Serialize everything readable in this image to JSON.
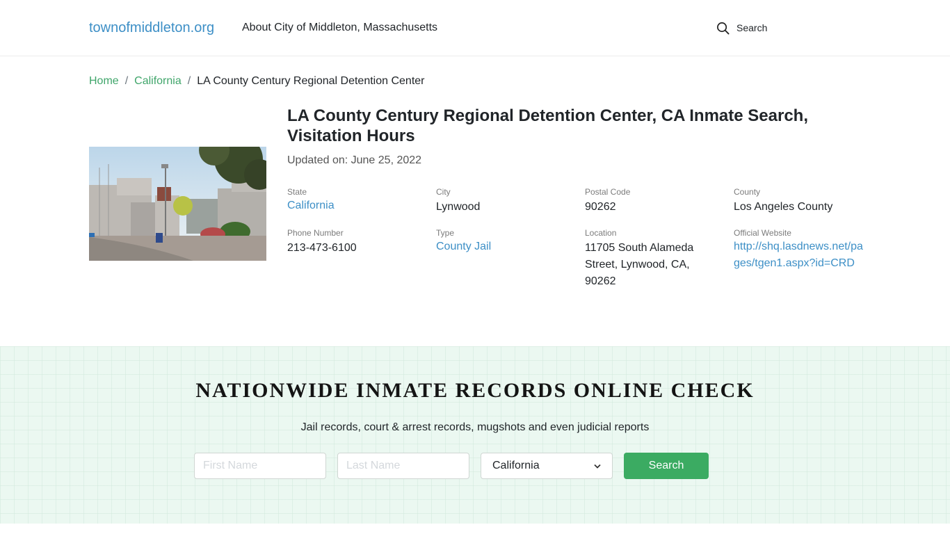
{
  "header": {
    "brand": "townofmiddleton.org",
    "nav_about": "About City of Middleton, Massachusetts",
    "search_label": "Search",
    "search_icon": "search-icon"
  },
  "breadcrumb": {
    "items": [
      {
        "label": "Home",
        "link": true
      },
      {
        "label": "California",
        "link": true
      },
      {
        "label": "LA County Century Regional Detention Center",
        "link": false
      }
    ],
    "separator": "/"
  },
  "facility": {
    "photo_alt": "LA County Century Regional Detention Center building",
    "title": "LA County Century Regional Detention Center, CA Inmate Search, Visitation Hours",
    "updated": "Updated on: June 25, 2022",
    "info": {
      "state": {
        "label": "State",
        "value": "California"
      },
      "city": {
        "label": "City",
        "value": "Lynwood"
      },
      "postal_code": {
        "label": "Postal Code",
        "value": "90262"
      },
      "county": {
        "label": "County",
        "value": "Los Angeles County"
      },
      "phone": {
        "label": "Phone Number",
        "value": "213-473-6100"
      },
      "type": {
        "label": "Type",
        "value": "County Jail"
      },
      "location": {
        "label": "Location",
        "value": "11705 South Alameda Street, Lynwood, CA, 90262"
      },
      "website": {
        "label": "Official Website",
        "value": "http://shq.lasdnews.net/pages/tgen1.aspx?id=CRD"
      }
    }
  },
  "nationwide": {
    "title": "NATIONWIDE INMATE RECORDS ONLINE CHECK",
    "subtitle": "Jail records, court & arrest records, mugshots and even judicial reports",
    "first_name_placeholder": "First Name",
    "last_name_placeholder": "Last Name",
    "state_selected": "California",
    "search_button": "Search"
  },
  "colors": {
    "brand_blue": "#3d8fc6",
    "breadcrumb_green": "#3fa56a",
    "button_green": "#3bab62",
    "section_bg": "#ebf8f1"
  }
}
